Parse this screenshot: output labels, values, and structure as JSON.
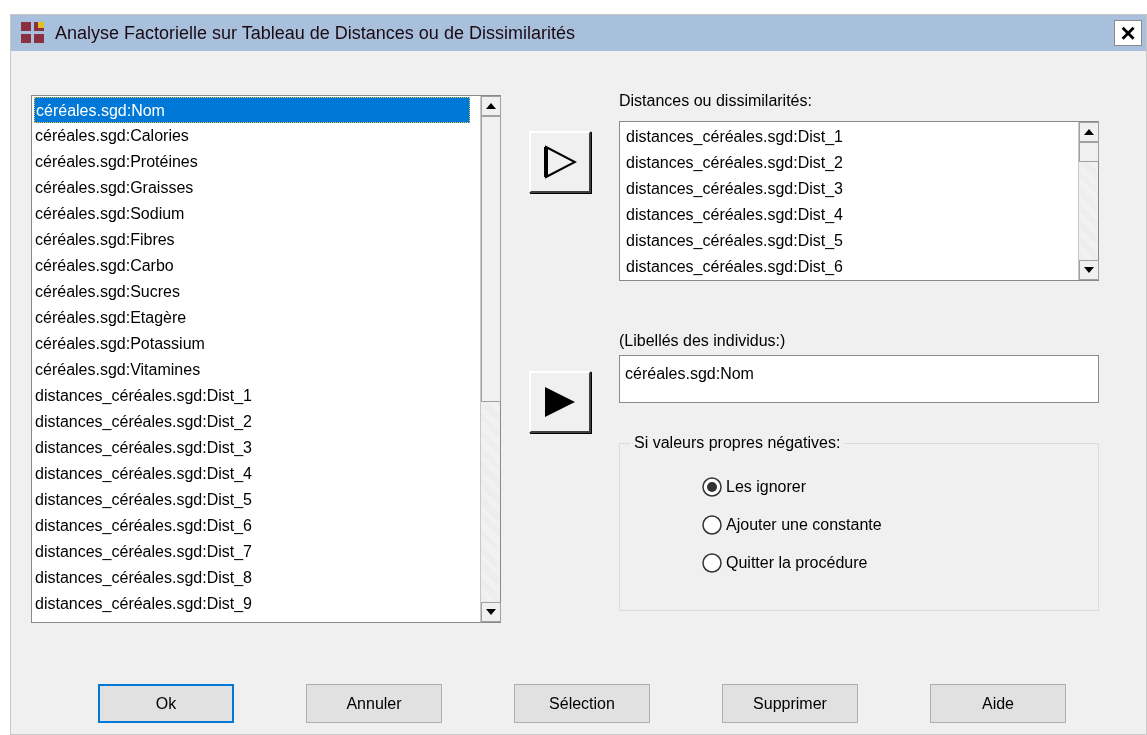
{
  "window": {
    "title": "Analyse Factorielle sur Tableau de Distances ou de Dissimilarités",
    "close": "×"
  },
  "variables": [
    {
      "label": "céréales.sgd:Nom",
      "selected": true
    },
    {
      "label": "céréales.sgd:Calories",
      "selected": false
    },
    {
      "label": "céréales.sgd:Protéines",
      "selected": false
    },
    {
      "label": "céréales.sgd:Graisses",
      "selected": false
    },
    {
      "label": "céréales.sgd:Sodium",
      "selected": false
    },
    {
      "label": "céréales.sgd:Fibres",
      "selected": false
    },
    {
      "label": "céréales.sgd:Carbo",
      "selected": false
    },
    {
      "label": "céréales.sgd:Sucres",
      "selected": false
    },
    {
      "label": "céréales.sgd:Etagère",
      "selected": false
    },
    {
      "label": "céréales.sgd:Potassium",
      "selected": false
    },
    {
      "label": "céréales.sgd:Vitamines",
      "selected": false
    },
    {
      "label": "distances_céréales.sgd:Dist_1",
      "selected": false
    },
    {
      "label": "distances_céréales.sgd:Dist_2",
      "selected": false
    },
    {
      "label": "distances_céréales.sgd:Dist_3",
      "selected": false
    },
    {
      "label": "distances_céréales.sgd:Dist_4",
      "selected": false
    },
    {
      "label": "distances_céréales.sgd:Dist_5",
      "selected": false
    },
    {
      "label": "distances_céréales.sgd:Dist_6",
      "selected": false
    },
    {
      "label": "distances_céréales.sgd:Dist_7",
      "selected": false
    },
    {
      "label": "distances_céréales.sgd:Dist_8",
      "selected": false
    },
    {
      "label": "distances_céréales.sgd:Dist_9",
      "selected": false
    }
  ],
  "distances": {
    "label": "Distances ou dissimilarités:",
    "items": [
      "distances_céréales.sgd:Dist_1",
      "distances_céréales.sgd:Dist_2",
      "distances_céréales.sgd:Dist_3",
      "distances_céréales.sgd:Dist_4",
      "distances_céréales.sgd:Dist_5",
      "distances_céréales.sgd:Dist_6"
    ]
  },
  "labels": {
    "label": "(Libellés des individus:)",
    "value": "céréales.sgd:Nom"
  },
  "negative_eigenvalues": {
    "label": "Si valeurs propres négatives:",
    "options": [
      {
        "label": "Les ignorer",
        "selected": true
      },
      {
        "label": "Ajouter une constante",
        "selected": false
      },
      {
        "label": "Quitter la procédure",
        "selected": false
      }
    ]
  },
  "buttons": [
    {
      "label": "Ok",
      "default": true
    },
    {
      "label": "Annuler",
      "default": false
    },
    {
      "label": "Sélection",
      "default": false
    },
    {
      "label": "Supprimer",
      "default": false
    },
    {
      "label": "Aide",
      "default": false
    }
  ]
}
